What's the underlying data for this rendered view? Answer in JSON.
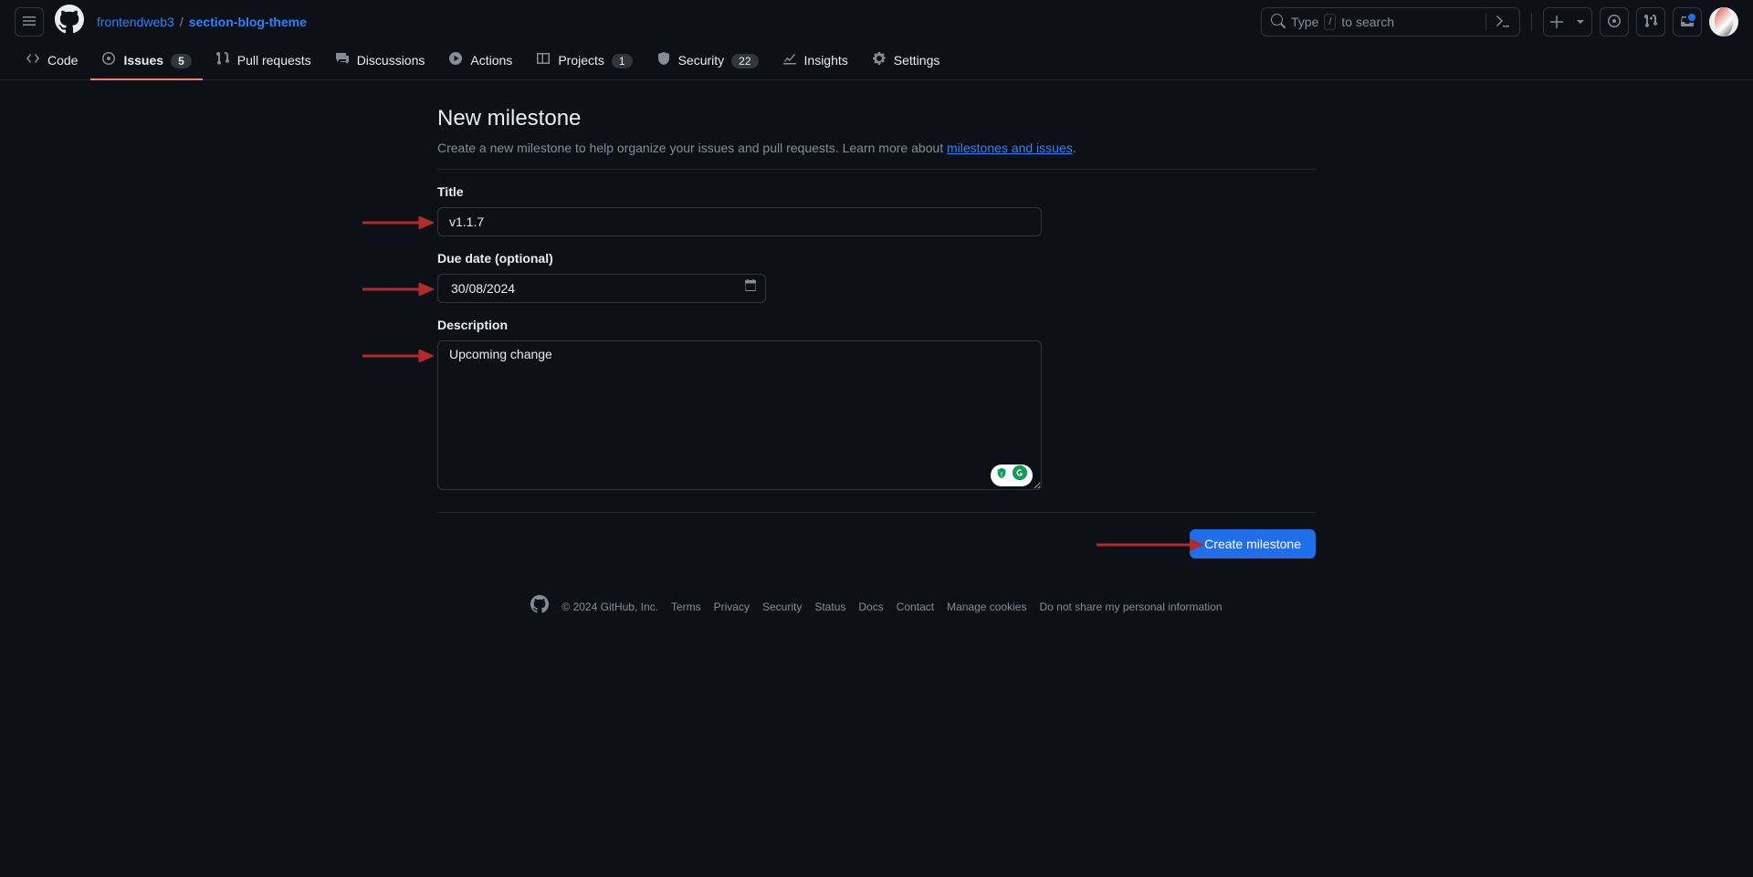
{
  "header": {
    "owner": "frontendweb3",
    "repo": "section-blog-theme",
    "search_type": "Type",
    "search_kbd": "/",
    "search_hint": "to search"
  },
  "nav": {
    "code": "Code",
    "issues": "Issues",
    "issues_count": "5",
    "pulls": "Pull requests",
    "discussions": "Discussions",
    "actions": "Actions",
    "projects": "Projects",
    "projects_count": "1",
    "security": "Security",
    "security_count": "22",
    "insights": "Insights",
    "settings": "Settings"
  },
  "page": {
    "title": "New milestone",
    "desc_pre": "Create a new milestone to help organize your issues and pull requests. Learn more about ",
    "desc_link": "milestones and issues",
    "desc_post": "."
  },
  "form": {
    "title_label": "Title",
    "title_value": "v1.1.7",
    "due_label": "Due date (optional)",
    "due_value": "30/08/2024",
    "desc_label": "Description",
    "desc_value": "Upcoming change",
    "submit": "Create milestone"
  },
  "footer": {
    "copyright": "© 2024 GitHub, Inc.",
    "links": [
      "Terms",
      "Privacy",
      "Security",
      "Status",
      "Docs",
      "Contact",
      "Manage cookies",
      "Do not share my personal information"
    ]
  },
  "colors": {
    "arrow": "#B22B2B",
    "primary": "#1f6feb"
  }
}
